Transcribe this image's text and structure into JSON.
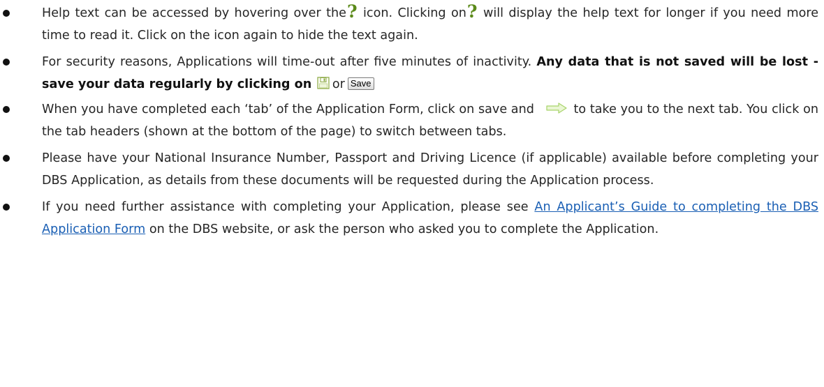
{
  "colors": {
    "help_icon": "#5b8a1a",
    "link": "#1a5fb4",
    "arrow": "#b7e07a"
  },
  "icons": {
    "help": "help-question-icon",
    "save": "floppy-disk-save-icon",
    "next": "next-arrow-icon"
  },
  "help_icon_glyph": "?",
  "items": [
    {
      "t1": "Help text can be accessed by hovering over the",
      "t2": " icon. Clicking on",
      "t3": " will display the help text for longer if you need more time to read it. Click on the icon again to hide the text again."
    },
    {
      "t1": "For security reasons, Applications will time-out after five minutes of inactivity.",
      "bold": "Any data that is not saved will be lost -  save your data regularly by clicking on",
      "t2": "or",
      "save_button": "Save"
    },
    {
      "t1": "When you have completed each ‘tab’ of the Application Form, click on save and",
      "t2": "to take you to the next tab. You click on the tab headers (shown at the bottom of the page) to switch between tabs."
    },
    {
      "t1": "Please have your National Insurance Number, Passport and Driving Licence (if applicable) available before completing your DBS Application, as details from these documents will be requested during the Application process."
    },
    {
      "t1": "If you need further assistance with completing your Application, please see",
      "link": "An Applicant’s Guide to completing the DBS Application Form",
      "t2": "on the DBS website, or ask the person who asked you to complete the Application."
    }
  ]
}
